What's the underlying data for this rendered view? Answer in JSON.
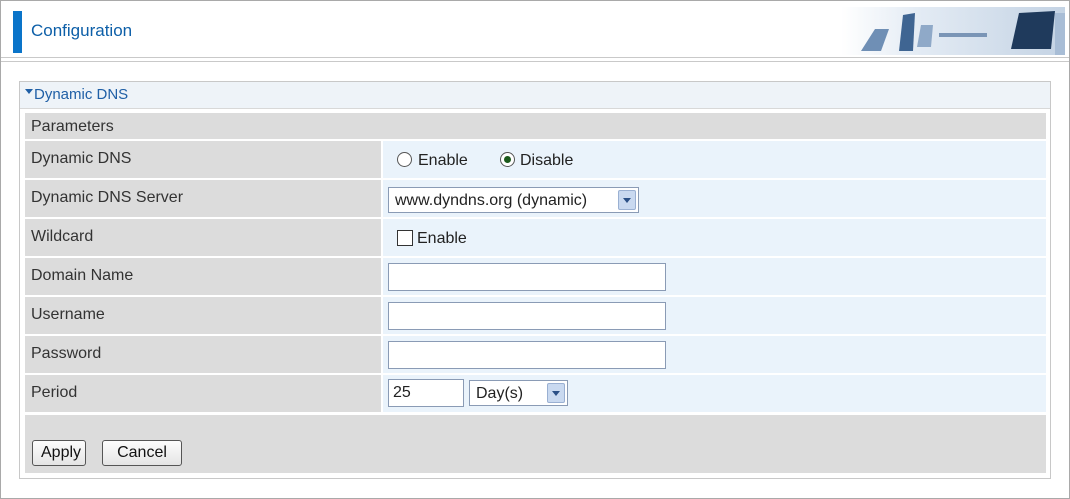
{
  "header": {
    "title": "Configuration",
    "accent_color": "#0a74c9",
    "banner_icon": "office-chairs-image"
  },
  "panel": {
    "title": "Dynamic DNS",
    "section_title": "Parameters"
  },
  "fields": {
    "dynamic_dns": {
      "label": "Dynamic DNS",
      "options": [
        "Enable",
        "Disable"
      ],
      "selected": "Disable"
    },
    "server": {
      "label": "Dynamic DNS Server",
      "value": "www.dyndns.org (dynamic)"
    },
    "wildcard": {
      "label": "Wildcard",
      "checkbox_label": "Enable",
      "checked": false
    },
    "domain_name": {
      "label": "Domain Name",
      "value": ""
    },
    "username": {
      "label": "Username",
      "value": ""
    },
    "password": {
      "label": "Password",
      "value": ""
    },
    "period": {
      "label": "Period",
      "value": "25",
      "unit": "Day(s)"
    }
  },
  "buttons": {
    "apply": "Apply",
    "cancel": "Cancel"
  }
}
